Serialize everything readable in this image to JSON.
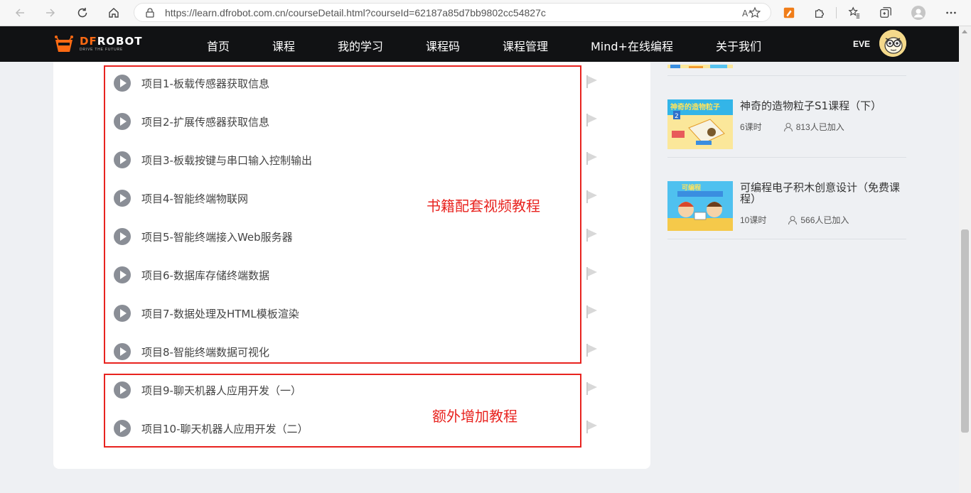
{
  "browser": {
    "url": "https://learn.dfrobot.com.cn/courseDetail.html?courseId=62187a85d7bb9802cc54827c"
  },
  "header": {
    "logo_main_a": "DF",
    "logo_main_b": "ROBOT",
    "logo_sub": "DRIVE THE FUTURE",
    "menu": [
      "首页",
      "课程",
      "我的学习",
      "课程码",
      "课程管理",
      "Mind+在线编程",
      "关于我们"
    ],
    "user_name": "EVE"
  },
  "lessons": [
    "项目1-板载传感器获取信息",
    "项目2-扩展传感器获取信息",
    "项目3-板载按键与串口输入控制输出",
    "项目4-智能终端物联网",
    "项目5-智能终端接入Web服务器",
    "项目6-数据库存储终端数据",
    "项目7-数据处理及HTML模板渲染",
    "项目8-智能终端数据可视化",
    "项目9-聊天机器人应用开发（一）",
    "项目10-聊天机器人应用开发（二）"
  ],
  "annotations": {
    "book_videos": "书籍配套视频教程",
    "extra": "额外增加教程"
  },
  "sidebar": {
    "courses": [
      {
        "title": "神奇的造物粒子S1课程（下）",
        "lessons": "6课时",
        "joined": "813人已加入",
        "thumb_text": "神奇的造物粒子"
      },
      {
        "title": "可编程电子积木创意设计（免费课程）",
        "lessons": "10课时",
        "joined": "566人已加入",
        "thumb_text": "可编程"
      }
    ]
  },
  "colors": {
    "accent": "#e8231f",
    "header_bg": "#111214",
    "brand": "#ff6a13"
  }
}
